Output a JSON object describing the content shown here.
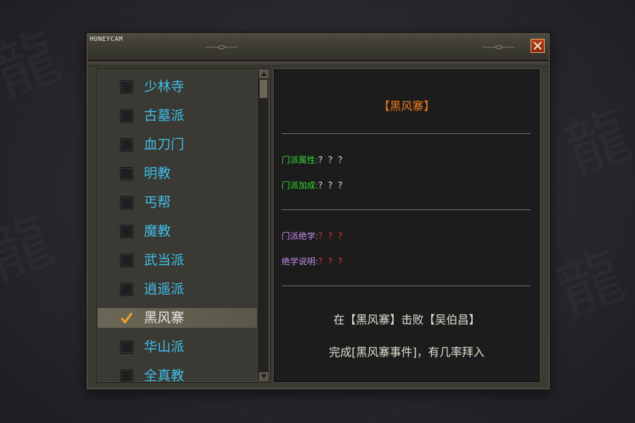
{
  "watermark": "HONEYCAM",
  "sects": [
    {
      "label": "少林寺",
      "checked": false,
      "selected": false
    },
    {
      "label": "古墓派",
      "checked": false,
      "selected": false
    },
    {
      "label": "血刀门",
      "checked": false,
      "selected": false
    },
    {
      "label": "明教",
      "checked": false,
      "selected": false
    },
    {
      "label": "丐帮",
      "checked": false,
      "selected": false
    },
    {
      "label": "魔教",
      "checked": false,
      "selected": false
    },
    {
      "label": "武当派",
      "checked": false,
      "selected": false
    },
    {
      "label": "逍遥派",
      "checked": false,
      "selected": false
    },
    {
      "label": "黑风寨",
      "checked": true,
      "selected": true
    },
    {
      "label": "华山派",
      "checked": false,
      "selected": false
    },
    {
      "label": "全真教",
      "checked": false,
      "selected": false
    }
  ],
  "detail": {
    "title": "【黑风寨】",
    "attr_label": "门派属性:",
    "attr_value": "？？？",
    "bonus_label": "门派加成:",
    "bonus_value": "？？？",
    "skill_label": "门派绝学:",
    "skill_value": "？？？",
    "desc_label": "绝学说明:",
    "desc_value": "？？？",
    "condition_line1": "在【黑风寨】击败【吴伯昌】",
    "condition_line2": "完成[黑风寨事件]，有几率拜入"
  },
  "colors": {
    "sect_name": "#40bfea",
    "title": "#f0761e",
    "label_green": "#37d437",
    "label_purple": "#c48de8",
    "value_red": "#ea3a3a",
    "close_button": "#a5361a"
  }
}
